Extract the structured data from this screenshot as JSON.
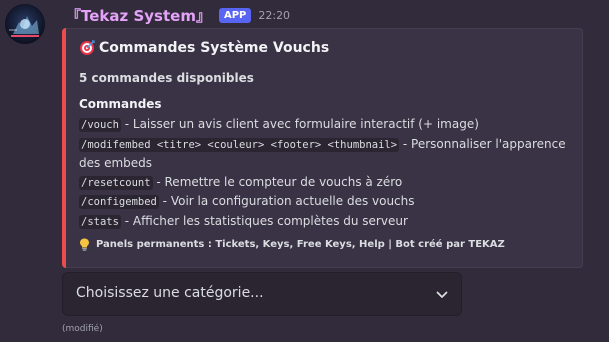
{
  "message": {
    "username": "『Tekaz System』",
    "badge": "APP",
    "timestamp": "22:20",
    "edited": "(modifié)"
  },
  "embed": {
    "title": "Commandes Système Vouchs",
    "description": "5 commandes disponibles",
    "field_name": "Commandes",
    "commands": [
      {
        "cmd": "/vouch",
        "desc": " - Laisser un avis client avec formulaire interactif (+ image)"
      },
      {
        "cmd": "/modifembed <titre> <couleur> <footer> <thumbnail>",
        "desc": " - Personnaliser l'apparence des embeds"
      },
      {
        "cmd": "/resetcount",
        "desc": " - Remettre le compteur de vouchs à zéro"
      },
      {
        "cmd": "/configembed",
        "desc": " - Voir la configuration actuelle des vouchs"
      },
      {
        "cmd": "/stats",
        "desc": " - Afficher les statistiques complètes du serveur"
      }
    ],
    "footer": "Panels permanents : Tickets, Keys, Free Keys, Help | Bot créé par TEKAZ",
    "accent_color": "#ec4c4c"
  },
  "select": {
    "placeholder": "Choisissez une catégorie..."
  },
  "icons": {
    "title_icon": "target-icon",
    "footer_icon": "bulb-icon",
    "select_icon": "chevron-down-icon"
  }
}
